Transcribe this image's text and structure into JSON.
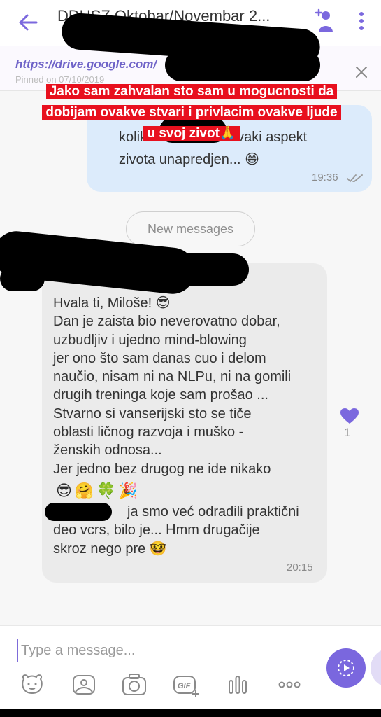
{
  "header": {
    "title": "DDUSZ Oktobar/Novembar 2...",
    "icons": {
      "back": "back-arrow-icon",
      "add_member": "add-member-icon",
      "menu": "kebab-menu-icon"
    }
  },
  "pinned": {
    "link": "https://drive.google.com/",
    "link_tail": "...",
    "date": "Pinned on 07/10/2019",
    "close_icon": "close-icon"
  },
  "overlay_caption": {
    "line1": "Jako sam zahvalan sto sam u mogucnosti da",
    "line2": "dobijam ovakve stvari i privlacim ovakve ljude",
    "line3": "u svoj zivot🙏"
  },
  "outgoing_message": {
    "line1": "koliko",
    "line1_tail": "vaki aspekt",
    "line2": "zivota unapredjen... 😁",
    "time": "19:36",
    "status_icon": "double-check-icon"
  },
  "new_messages_label": "New messages",
  "incoming_message": {
    "text": "Hvala ti, Miloše! 😎\nDan je zaista bio neverovatno dobar,\nuzbudljiv i ujedno mind-blowing\njer ono što sam danas cuo i delom\nnaučio, nisam ni na NLPu, ni na gomili\ndrugih treninga koje sam prošao ...\nStvarno si vanserijski sto se tiče\noblasti ličnog razvoja i muško -\nženskih odnosa...\nJer jedno bez drugog ne ide nikako",
    "emoji_row": "😎🤗🍀🎉",
    "text2_tail": "ja smo već odradili praktični",
    "text3": "deo vcrs, bilo je... Hmm drugačije",
    "text4": "skroz nego pre 🤓",
    "time": "20:15"
  },
  "reaction": {
    "icon": "heart-icon",
    "count": "1",
    "color": "#7b68de"
  },
  "composer": {
    "placeholder": "Type a message...",
    "tools": [
      "sticker-icon",
      "gallery-icon",
      "camera-icon",
      "gif-icon",
      "voice-icon",
      "more-icon"
    ],
    "send_icon": "send-video-icon"
  },
  "colors": {
    "accent": "#7b68de",
    "caption_bg": "#e8101e",
    "outgoing_bubble": "#dcebfb",
    "incoming_bubble": "#ebebeb"
  }
}
